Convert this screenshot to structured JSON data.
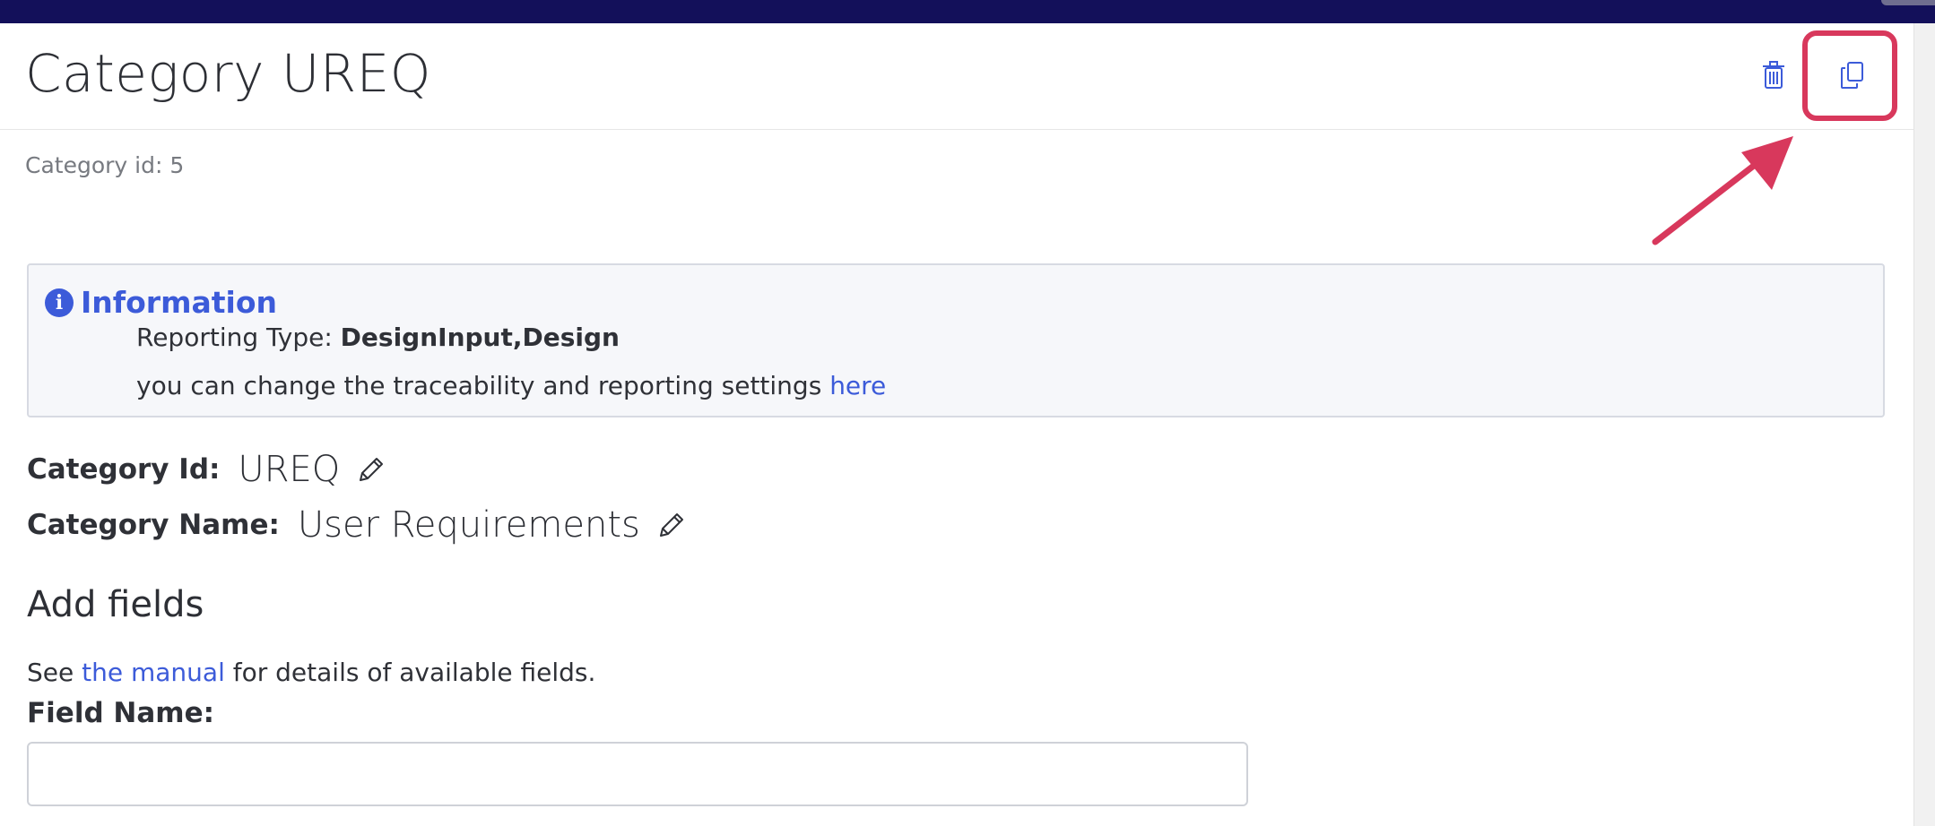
{
  "header": {
    "title": "Category UREQ",
    "delete_icon": "trash-icon",
    "copy_icon": "copy-icon"
  },
  "meta": {
    "category_id_text": "Category id: 5"
  },
  "info": {
    "title": "Information",
    "icon": "info-circle-icon",
    "reporting_label": "Reporting Type: ",
    "reporting_value": "DesignInput,Design",
    "change_text": "you can change the traceability and reporting settings ",
    "change_link": "here"
  },
  "fields": {
    "category_id_label": "Category Id:",
    "category_id_value": "UREQ",
    "category_name_label": "Category Name:",
    "category_name_value": "User Requirements",
    "edit_icon": "pencil-icon"
  },
  "add_fields": {
    "title": "Add fields",
    "manual_prefix": "See ",
    "manual_link": "the manual",
    "manual_suffix": " for details of available fields.",
    "field_name_label": "Field Name:",
    "field_name_value": ""
  },
  "colors": {
    "topbar": "#13105a",
    "accent": "#3c5bd9",
    "highlight": "#d8385c"
  }
}
